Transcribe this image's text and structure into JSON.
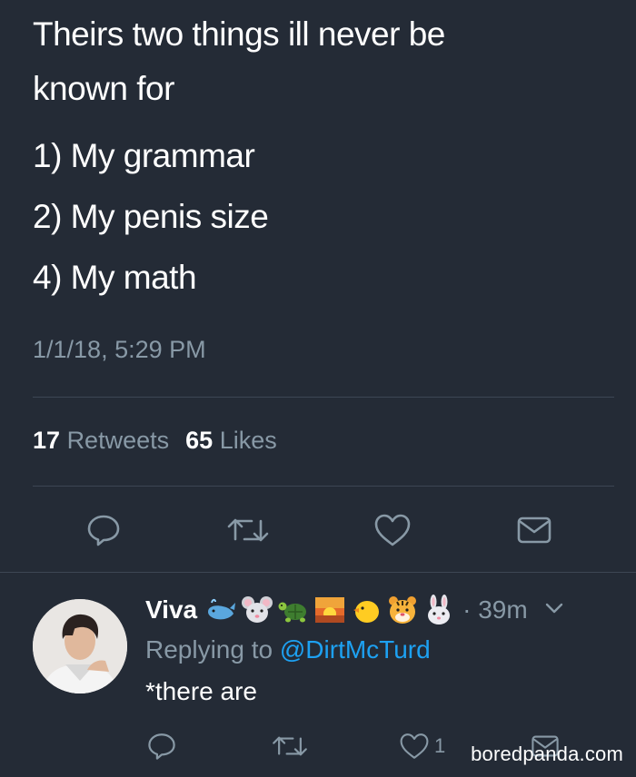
{
  "tweet": {
    "text_lines": [
      "Theirs two things ill never be",
      "known for"
    ],
    "list": [
      "1) My grammar",
      "2) My penis size",
      "4) My math"
    ],
    "timestamp": "1/1/18, 5:29 PM",
    "retweets_count": "17",
    "retweets_label": "Retweets",
    "likes_count": "65",
    "likes_label": "Likes"
  },
  "reply": {
    "name": "Viva",
    "emojis": [
      "whale-emoji",
      "mouse-emoji",
      "turtle-emoji",
      "sunrise-emoji",
      "chick-emoji",
      "tiger-emoji",
      "rabbit-emoji"
    ],
    "time": "· 39m",
    "replying_prefix": "Replying to",
    "replying_handle": "@DirtMcTurd",
    "text": "*there are",
    "like_count": "1"
  },
  "watermark": "boredpanda.com",
  "colors": {
    "background": "#242b36",
    "muted": "#8899a6",
    "link": "#1da1f2",
    "divider": "#3d4654"
  }
}
